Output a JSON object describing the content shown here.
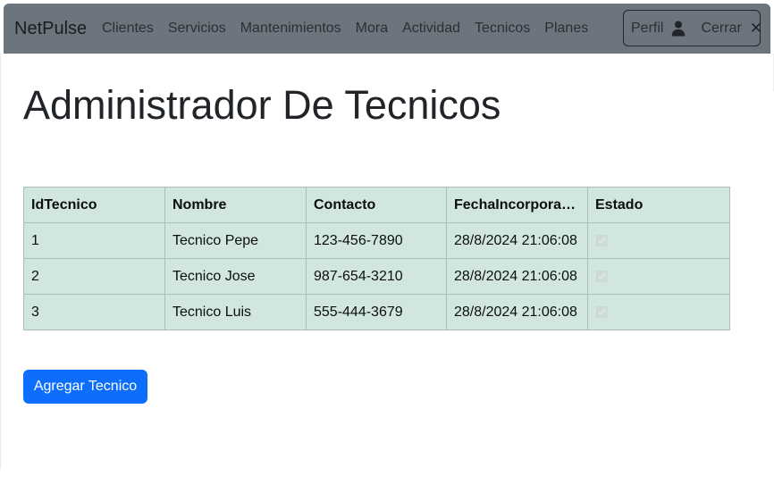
{
  "navbar": {
    "brand": "NetPulse",
    "links": [
      "Clientes",
      "Servicios",
      "Mantenimientos",
      "Mora",
      "Actividad",
      "Tecnicos",
      "Planes"
    ],
    "profile_label": "Perfil",
    "profile_icon": "user-icon",
    "logout_label": "Cerrar",
    "logout_icon": "close-icon",
    "background_color": "#6c757d"
  },
  "page": {
    "title": "Administrador De Tecnicos"
  },
  "table": {
    "columns": [
      "IdTecnico",
      "Nombre",
      "Contacto",
      "FechaIncorporac...",
      "Estado"
    ],
    "rows": [
      {
        "id": "1",
        "nombre": "Tecnico Pepe",
        "contacto": "123-456-7890",
        "fecha": "28/8/2024 21:06:08",
        "estado": true
      },
      {
        "id": "2",
        "nombre": "Tecnico Jose",
        "contacto": "987-654-3210",
        "fecha": "28/8/2024 21:06:08",
        "estado": true
      },
      {
        "id": "3",
        "nombre": "Tecnico Luis",
        "contacto": "555-444-3679",
        "fecha": "28/8/2024 21:06:08",
        "estado": true
      }
    ],
    "row_color": "#d1e7dd"
  },
  "actions": {
    "add_label": "Agregar Tecnico",
    "add_color": "#0d6efd"
  }
}
